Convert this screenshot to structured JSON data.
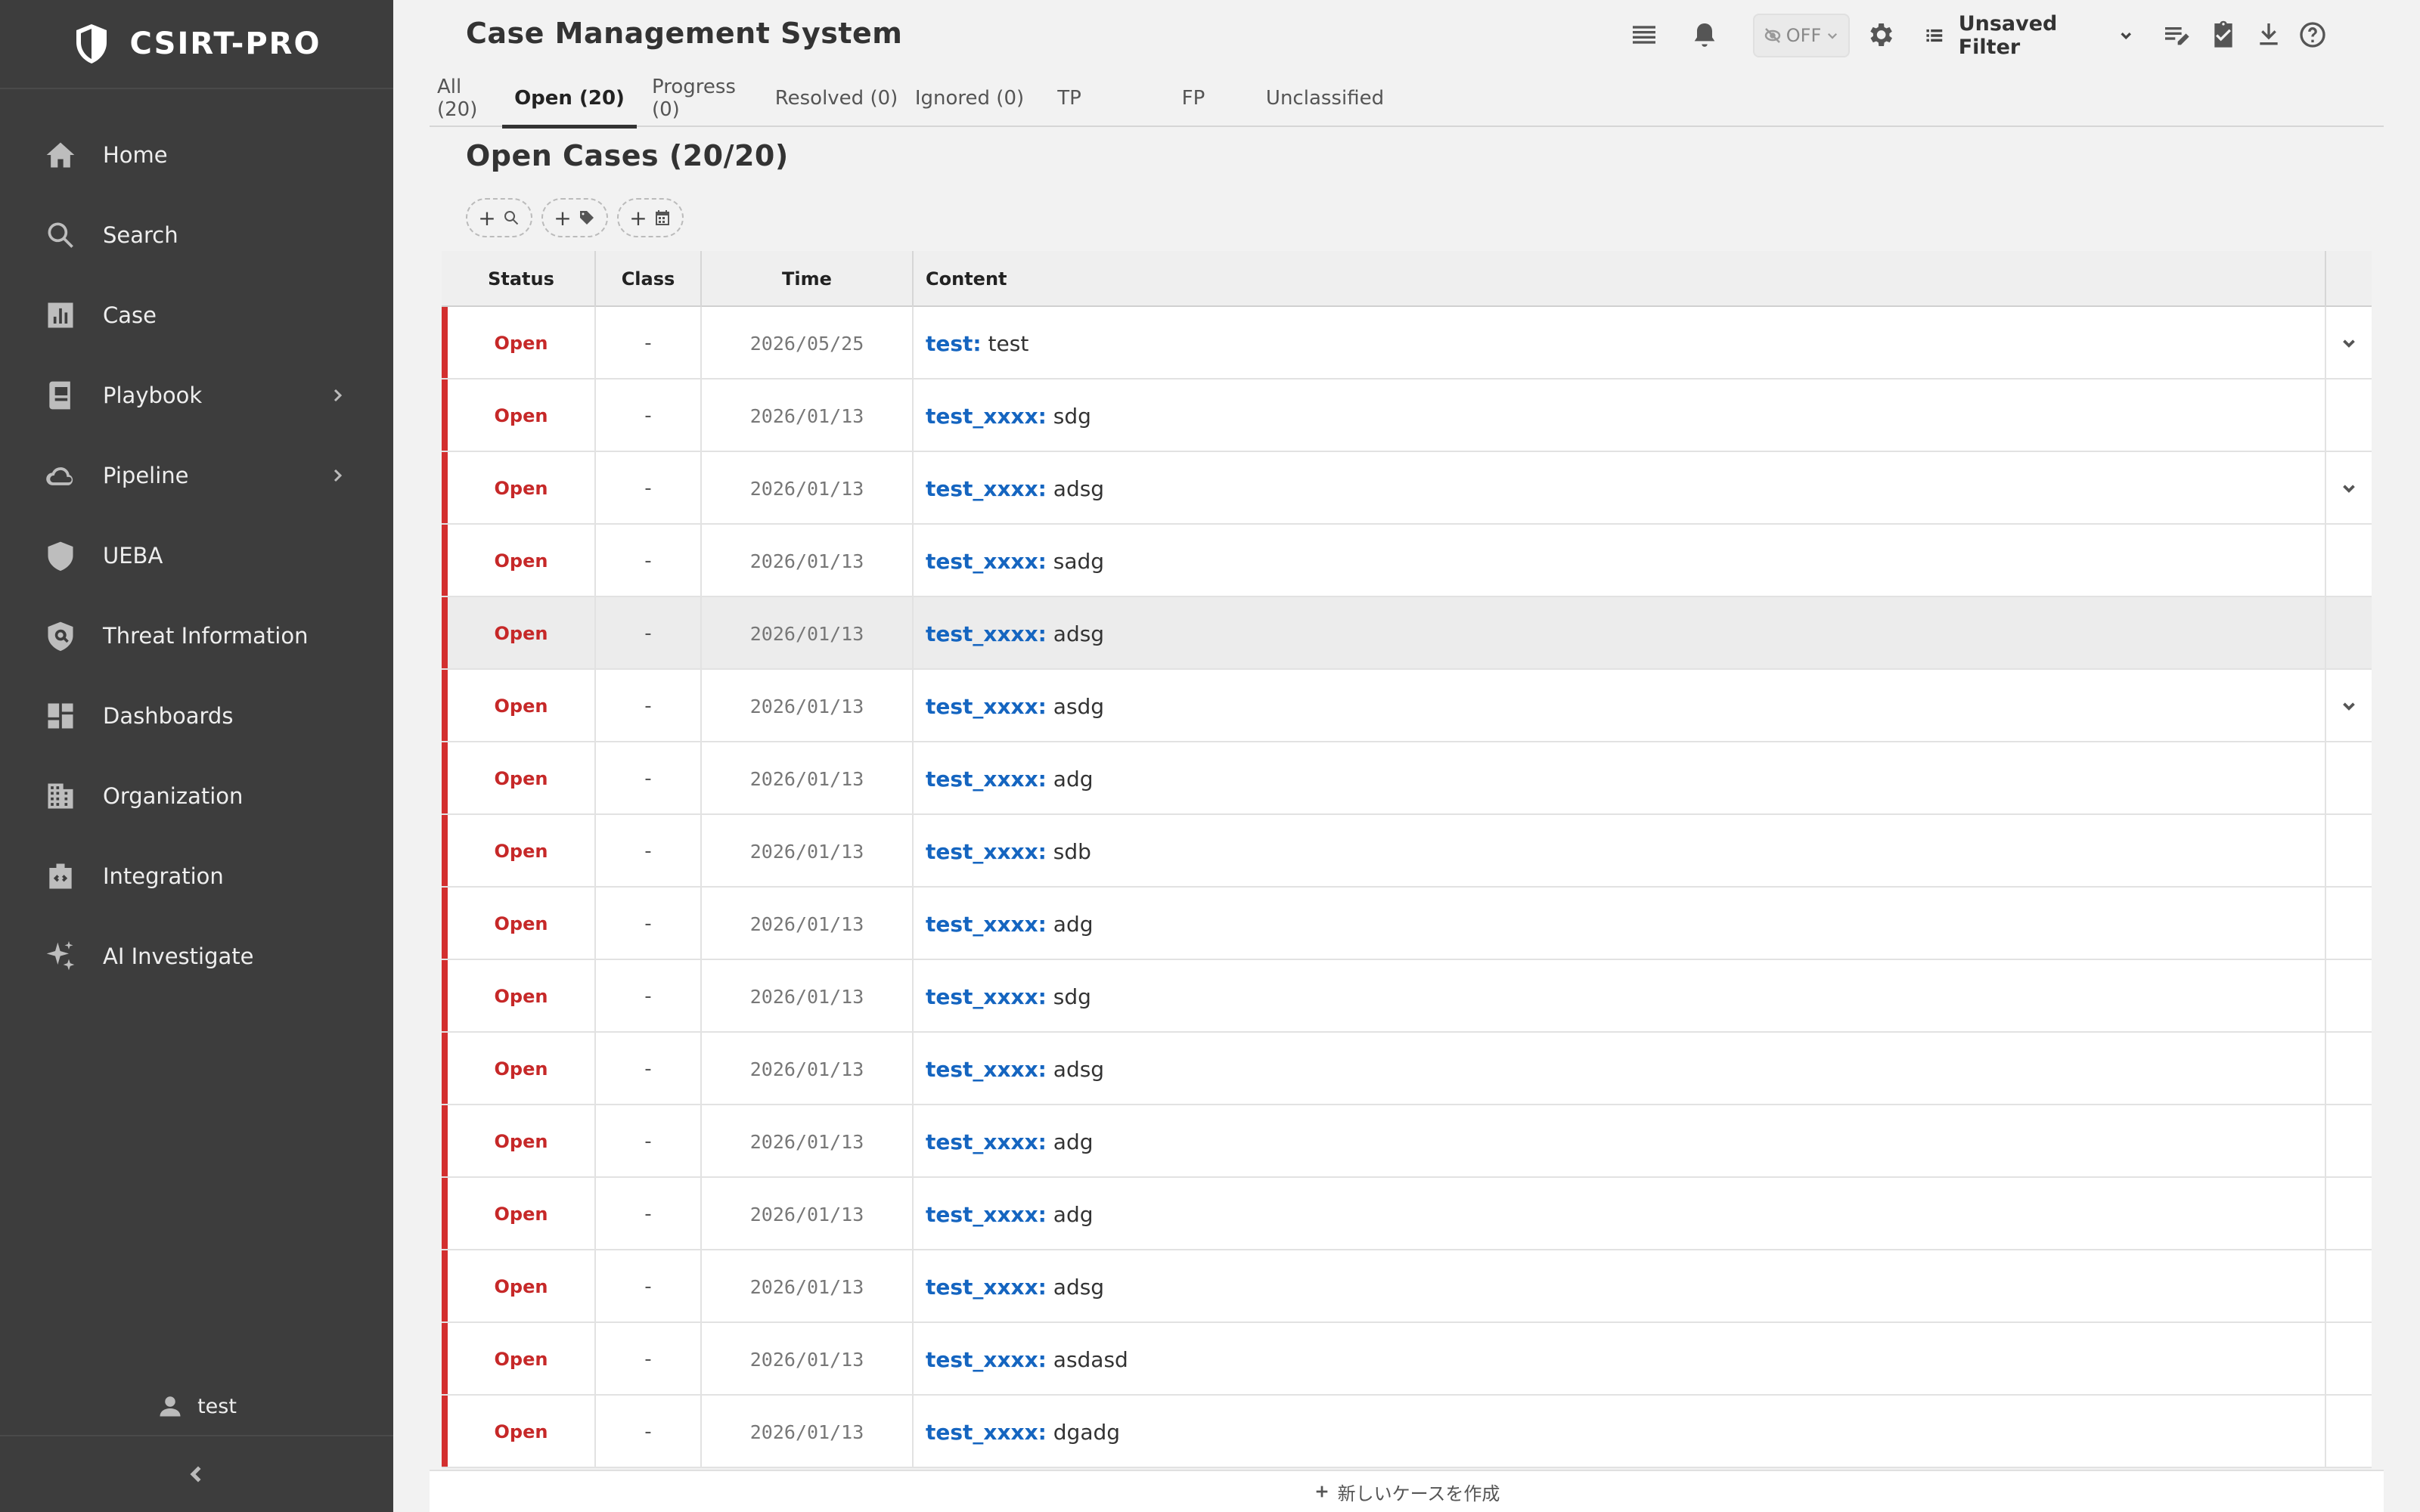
{
  "brand": {
    "name": "CSIRT-PRO"
  },
  "sidebar": {
    "items": [
      {
        "label": "Home",
        "icon": "home-icon"
      },
      {
        "label": "Search",
        "icon": "search-icon"
      },
      {
        "label": "Case",
        "icon": "bar-chart-icon"
      },
      {
        "label": "Playbook",
        "icon": "book-icon",
        "expandable": true
      },
      {
        "label": "Pipeline",
        "icon": "cloud-icon",
        "expandable": true
      },
      {
        "label": "UEBA",
        "icon": "shield-icon"
      },
      {
        "label": "Threat Information",
        "icon": "threat-shield-icon"
      },
      {
        "label": "Dashboards",
        "icon": "dashboard-icon"
      },
      {
        "label": "Organization",
        "icon": "building-icon"
      },
      {
        "label": "Integration",
        "icon": "integration-icon"
      },
      {
        "label": "AI Investigate",
        "icon": "sparkle-icon"
      }
    ],
    "user": "test"
  },
  "header": {
    "title": "Case Management System",
    "toggle_label": "OFF",
    "filter_label": "Unsaved Filter"
  },
  "tabs": [
    {
      "label": "All (20)",
      "active": false
    },
    {
      "label": "Open (20)",
      "active": true
    },
    {
      "label": "Progress (0)",
      "active": false
    },
    {
      "label": "Resolved (0)",
      "active": false
    },
    {
      "label": "Ignored (0)",
      "active": false
    },
    {
      "label": "TP",
      "active": false
    },
    {
      "label": "FP",
      "active": false
    },
    {
      "label": "Unclassified",
      "active": false
    }
  ],
  "section": {
    "title": "Open Cases (20/20)"
  },
  "table": {
    "columns": [
      "Status",
      "Class",
      "Time",
      "Content"
    ],
    "rows": [
      {
        "status": "Open",
        "class": "-",
        "time": "2026/05/25",
        "key": "test:",
        "text": "test",
        "expand": true
      },
      {
        "status": "Open",
        "class": "-",
        "time": "2026/01/13",
        "key": "test_xxxx:",
        "text": "sdg",
        "expand": false
      },
      {
        "status": "Open",
        "class": "-",
        "time": "2026/01/13",
        "key": "test_xxxx:",
        "text": "adsg",
        "expand": true
      },
      {
        "status": "Open",
        "class": "-",
        "time": "2026/01/13",
        "key": "test_xxxx:",
        "text": "sadg",
        "expand": false
      },
      {
        "status": "Open",
        "class": "-",
        "time": "2026/01/13",
        "key": "test_xxxx:",
        "text": "adsg",
        "expand": false,
        "hover": true
      },
      {
        "status": "Open",
        "class": "-",
        "time": "2026/01/13",
        "key": "test_xxxx:",
        "text": "asdg",
        "expand": true
      },
      {
        "status": "Open",
        "class": "-",
        "time": "2026/01/13",
        "key": "test_xxxx:",
        "text": "adg",
        "expand": false
      },
      {
        "status": "Open",
        "class": "-",
        "time": "2026/01/13",
        "key": "test_xxxx:",
        "text": "sdb",
        "expand": false
      },
      {
        "status": "Open",
        "class": "-",
        "time": "2026/01/13",
        "key": "test_xxxx:",
        "text": "adg",
        "expand": false
      },
      {
        "status": "Open",
        "class": "-",
        "time": "2026/01/13",
        "key": "test_xxxx:",
        "text": "sdg",
        "expand": false
      },
      {
        "status": "Open",
        "class": "-",
        "time": "2026/01/13",
        "key": "test_xxxx:",
        "text": "adsg",
        "expand": false
      },
      {
        "status": "Open",
        "class": "-",
        "time": "2026/01/13",
        "key": "test_xxxx:",
        "text": "adg",
        "expand": false
      },
      {
        "status": "Open",
        "class": "-",
        "time": "2026/01/13",
        "key": "test_xxxx:",
        "text": "adg",
        "expand": false
      },
      {
        "status": "Open",
        "class": "-",
        "time": "2026/01/13",
        "key": "test_xxxx:",
        "text": "adsg",
        "expand": false
      },
      {
        "status": "Open",
        "class": "-",
        "time": "2026/01/13",
        "key": "test_xxxx:",
        "text": "asdasd",
        "expand": false
      },
      {
        "status": "Open",
        "class": "-",
        "time": "2026/01/13",
        "key": "test_xxxx:",
        "text": "dgadg",
        "expand": false
      }
    ]
  },
  "footer": {
    "create_label": "新しいケースを作成"
  },
  "colors": {
    "sidebar_bg": "#3d3d3d",
    "status_open": "#c62828",
    "link": "#1565c0"
  }
}
